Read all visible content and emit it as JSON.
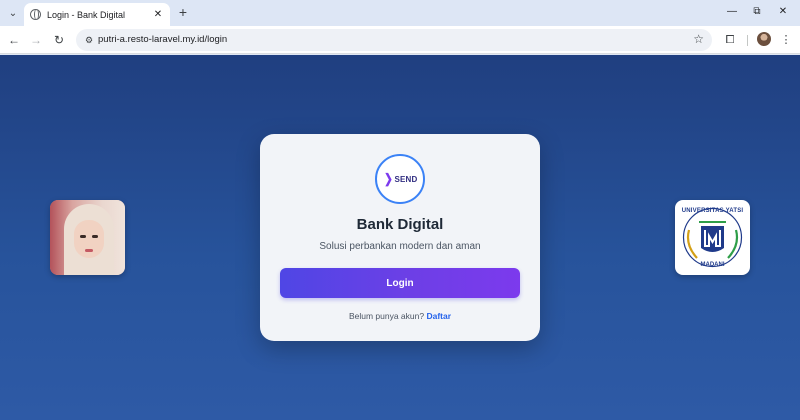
{
  "browser": {
    "tab_title": "Login - Bank Digital",
    "url": "putri-a.resto-laravel.my.id/login",
    "icons": {
      "tab_search": "chevron-down-icon",
      "favicon": "globe-icon",
      "tab_close": "close-icon",
      "new_tab": "plus-icon",
      "minimize": "minimize-icon",
      "restore": "restore-icon",
      "close_window": "close-icon",
      "back": "back-arrow-icon",
      "forward": "forward-arrow-icon",
      "reload": "reload-icon",
      "site_info": "tune-icon",
      "bookmark": "star-icon",
      "extensions": "puzzle-icon",
      "menu": "kebab-menu-icon"
    },
    "glyphs": {
      "tab_search": "⌄",
      "tab_close": "✕",
      "new_tab": "+",
      "minimize": "—",
      "restore": "⧉",
      "close_window": "✕",
      "back": "←",
      "forward": "→",
      "reload": "↻",
      "site_info": "⚙",
      "bookmark": "☆",
      "extensions": "⧠",
      "menu": "⋮"
    }
  },
  "page": {
    "card": {
      "logo_text": "SEND",
      "logo_chevron": "❯",
      "title": "Bank Digital",
      "subtitle": "Solusi perbankan modern dan aman",
      "login_button": "Login",
      "footer_text": "Belum punya akun?",
      "register_link": "Daftar"
    },
    "university_logo": {
      "top_text": "UNIVERSITAS YATSI",
      "bottom_text": "MADANI"
    },
    "colors": {
      "background": "#27539b",
      "card": "#f2f4f8",
      "button_start": "#4f46e5",
      "button_end": "#7c3aed",
      "link": "#2563eb"
    }
  }
}
